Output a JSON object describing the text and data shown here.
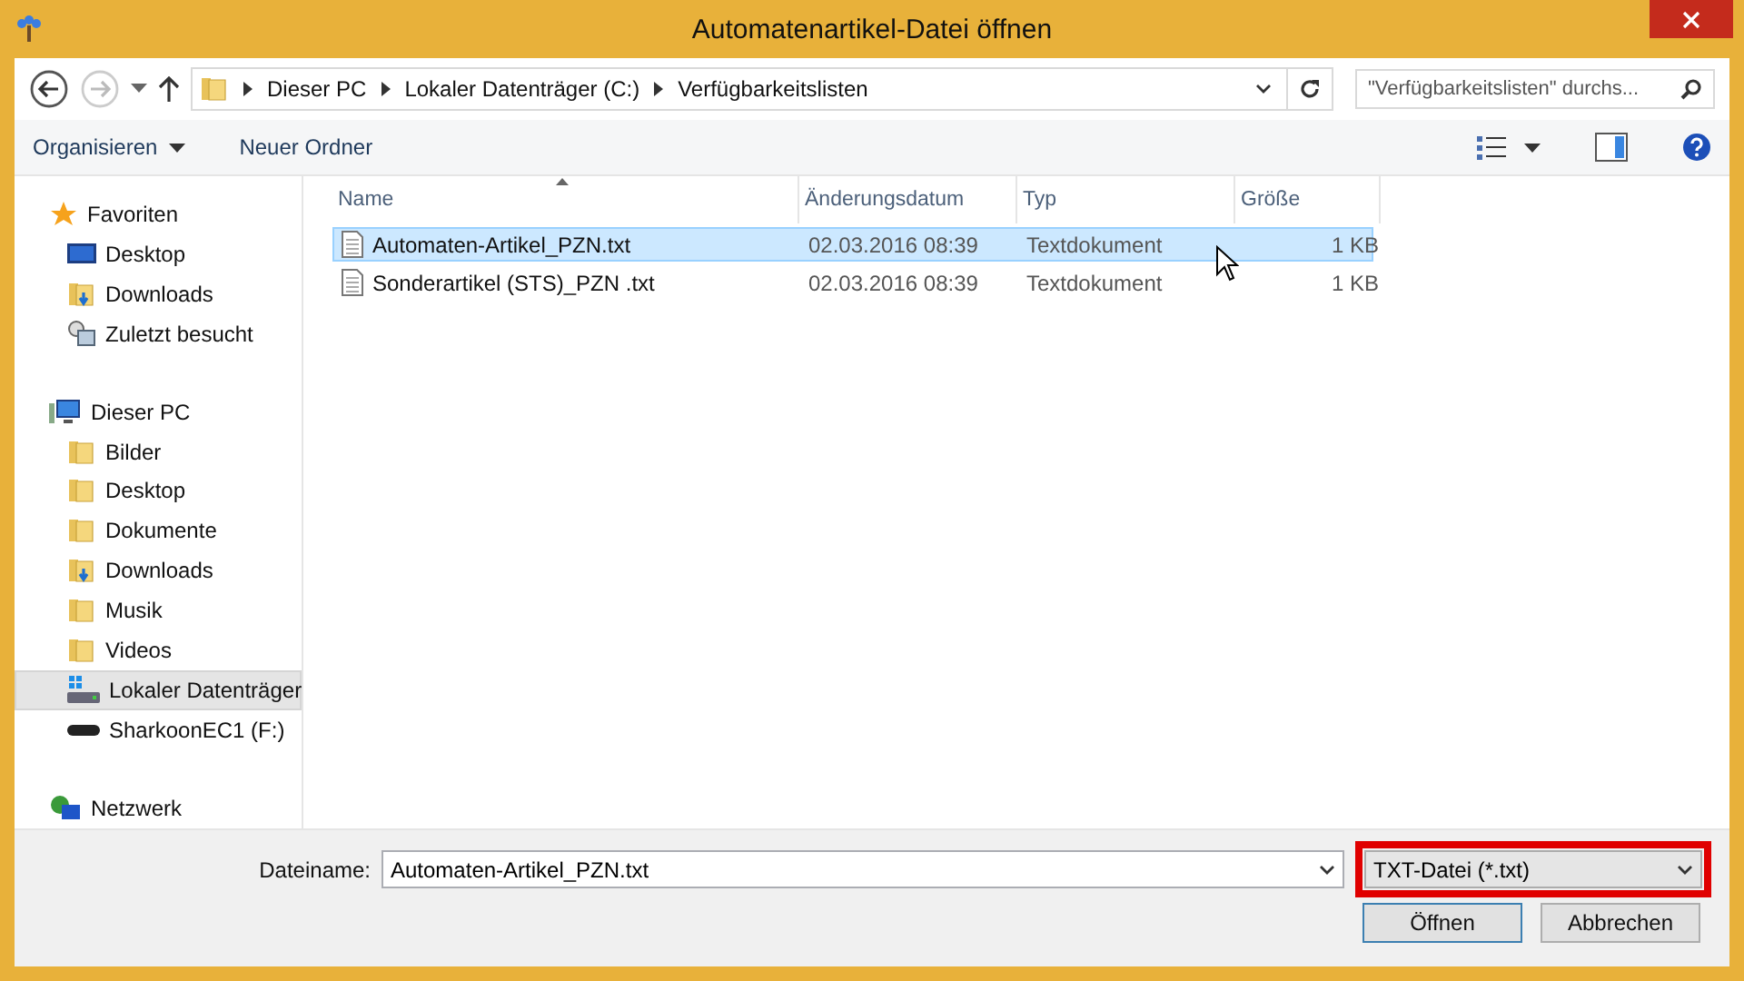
{
  "window": {
    "title": "Automatenartikel-Datei öffnen"
  },
  "address": {
    "crumbs": [
      "Dieser PC",
      "Lokaler Datenträger (C:)",
      "Verfügbarkeitslisten"
    ],
    "search_placeholder": "\"Verfügbarkeitslisten\" durchs..."
  },
  "toolbar": {
    "organize": "Organisieren",
    "new_folder": "Neuer Ordner"
  },
  "sidebar": {
    "groups": [
      {
        "label": "Favoriten",
        "kind": "star",
        "children": [
          {
            "label": "Desktop",
            "kind": "monitor",
            "selected": false
          },
          {
            "label": "Downloads",
            "kind": "download",
            "selected": false
          },
          {
            "label": "Zuletzt besucht",
            "kind": "recent",
            "selected": false
          }
        ]
      },
      {
        "label": "Dieser PC",
        "kind": "pc",
        "children": [
          {
            "label": "Bilder",
            "kind": "folder",
            "selected": false
          },
          {
            "label": "Desktop",
            "kind": "folder",
            "selected": false
          },
          {
            "label": "Dokumente",
            "kind": "folder",
            "selected": false
          },
          {
            "label": "Downloads",
            "kind": "download",
            "selected": false
          },
          {
            "label": "Musik",
            "kind": "folder",
            "selected": false
          },
          {
            "label": "Videos",
            "kind": "folder",
            "selected": false
          },
          {
            "label": "Lokaler Datenträger",
            "kind": "drive",
            "selected": true
          },
          {
            "label": "SharkoonEC1 (F:)",
            "kind": "usb",
            "selected": false
          }
        ]
      },
      {
        "label": "Netzwerk",
        "kind": "network"
      }
    ]
  },
  "table": {
    "columns": [
      "Name",
      "Änderungsdatum",
      "Typ",
      "Größe"
    ],
    "rows": [
      {
        "name": "Automaten-Artikel_PZN.txt",
        "date": "02.03.2016 08:39",
        "type": "Textdokument",
        "size": "1 KB",
        "selected": true
      },
      {
        "name": "Sonderartikel (STS)_PZN .txt",
        "date": "02.03.2016 08:39",
        "type": "Textdokument",
        "size": "1 KB",
        "selected": false
      }
    ]
  },
  "footer": {
    "filename_label": "Dateiname:",
    "filename": "Automaten-Artikel_PZN.txt",
    "filetype": "TXT-Datei (*.txt)",
    "filetype_highlighted": true,
    "buttons": [
      "Öffnen",
      "Abbrechen"
    ]
  }
}
